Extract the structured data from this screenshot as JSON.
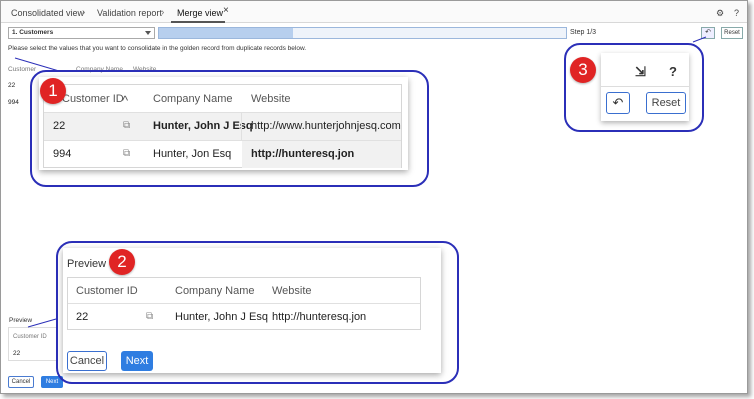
{
  "tabs": [
    {
      "label": "Consolidated view"
    },
    {
      "label": "Validation report"
    },
    {
      "label": "Merge view"
    }
  ],
  "breadcrumb_separator": "›",
  "close_glyph": "×",
  "top_icons": {
    "settings": "⚙",
    "help": "?"
  },
  "stepper": {
    "selected": "1. Customers",
    "progress_fraction": 0.33,
    "step_text": "Step 1/3",
    "undo_glyph": "↶",
    "reset_label": "Reset"
  },
  "instruction": "Please select the values that you want to consolidate in the golden record from duplicate records below.",
  "background_table": {
    "headers": [
      "Customer",
      "Company Name",
      "Website"
    ],
    "rows": [
      "22",
      "994"
    ]
  },
  "background_preview": {
    "label": "Preview",
    "header": "Customer ID",
    "value": "22",
    "cancel_label": "Cancel",
    "next_label": "Next"
  },
  "callout1": {
    "badge": "1",
    "headers": [
      "Customer ID",
      "Company Name",
      "Website"
    ],
    "sort_glyph": "^",
    "rows": [
      {
        "id": "22",
        "company": "Hunter, John J Esq",
        "website": "http://www.hunterjohnjesq.com"
      },
      {
        "id": "994",
        "company": "Hunter, Jon Esq",
        "website": "http://hunteresq.jon"
      }
    ]
  },
  "callout2": {
    "badge": "2",
    "title": "Preview",
    "headers": [
      "Customer ID",
      "Company Name",
      "Website"
    ],
    "row": {
      "id": "22",
      "company": "Hunter, John J Esq",
      "website": "http://hunteresq.jon"
    },
    "cancel_label": "Cancel",
    "next_label": "Next"
  },
  "callout3": {
    "badge": "3",
    "collapse_glyph": "⇲",
    "help_glyph": "?",
    "undo_glyph": "↶",
    "reset_label": "Reset"
  },
  "colors": {
    "accent": "#2f7de1",
    "callout_border": "#2b2fb8",
    "badge": "#e02424"
  }
}
